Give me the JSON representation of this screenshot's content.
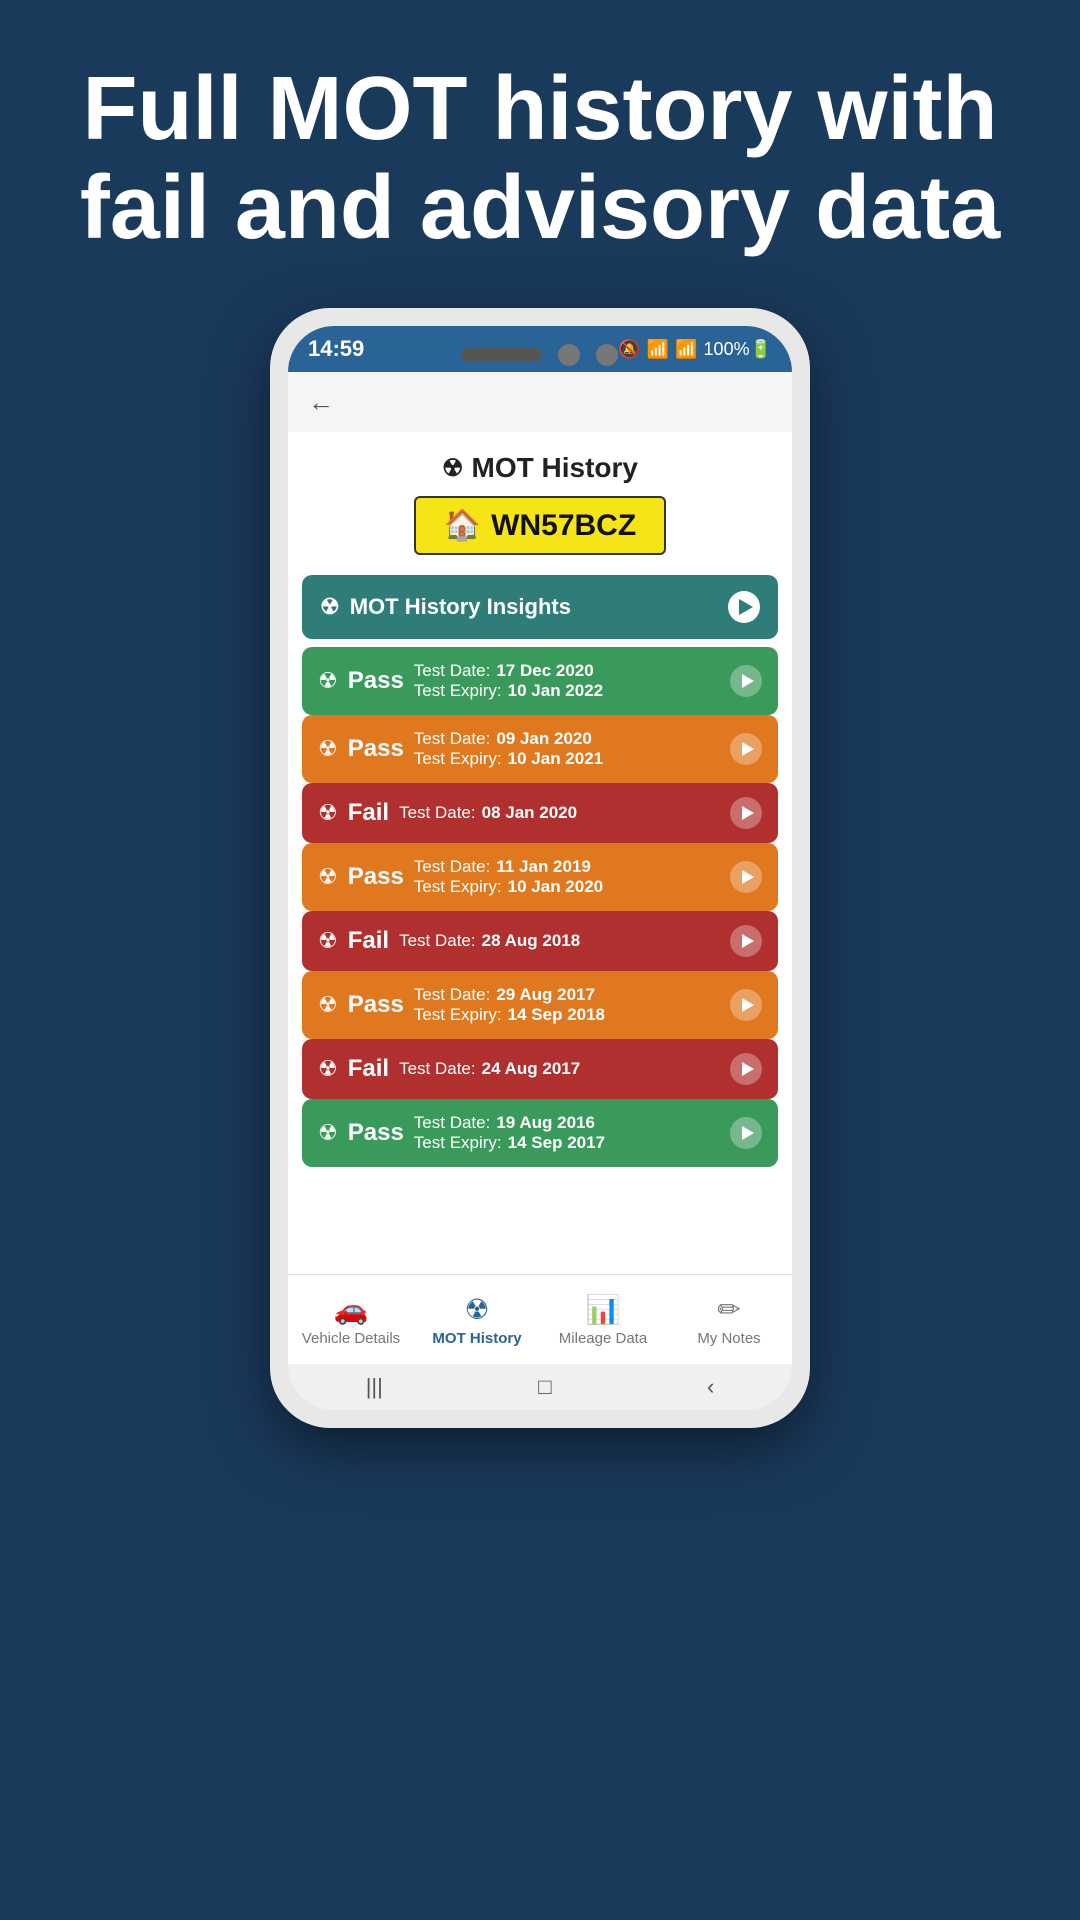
{
  "page": {
    "background_color": "#1a3a5c",
    "header_line1": "Full MOT history with",
    "header_line2": "fail and advisory data"
  },
  "status_bar": {
    "time": "14:59",
    "icons": "🔕 📶 📶 100%🔋"
  },
  "screen": {
    "title": "MOT History",
    "plate": "WN57BCZ",
    "insights_label": "MOT History Insights",
    "mot_entries": [
      {
        "result": "Pass",
        "color": "pass-green",
        "test_date_label": "Test Date:",
        "test_date_value": "17 Dec 2020",
        "expiry_label": "Test Expiry:",
        "expiry_value": "10 Jan 2022"
      },
      {
        "result": "Pass",
        "color": "pass-orange",
        "test_date_label": "Test Date:",
        "test_date_value": "09 Jan 2020",
        "expiry_label": "Test Expiry:",
        "expiry_value": "10 Jan 2021"
      },
      {
        "result": "Fail",
        "color": "fail-red",
        "test_date_label": "Test Date:",
        "test_date_value": "08 Jan 2020",
        "expiry_label": null,
        "expiry_value": null
      },
      {
        "result": "Pass",
        "color": "pass-orange",
        "test_date_label": "Test Date:",
        "test_date_value": "11 Jan 2019",
        "expiry_label": "Test Expiry:",
        "expiry_value": "10 Jan 2020"
      },
      {
        "result": "Fail",
        "color": "fail-red",
        "test_date_label": "Test Date:",
        "test_date_value": "28 Aug 2018",
        "expiry_label": null,
        "expiry_value": null
      },
      {
        "result": "Pass",
        "color": "pass-orange",
        "test_date_label": "Test Date:",
        "test_date_value": "29 Aug 2017",
        "expiry_label": "Test Expiry:",
        "expiry_value": "14 Sep 2018"
      },
      {
        "result": "Fail",
        "color": "fail-red",
        "test_date_label": "Test Date:",
        "test_date_value": "24 Aug 2017",
        "expiry_label": null,
        "expiry_value": null
      },
      {
        "result": "Pass",
        "color": "pass-green",
        "test_date_label": "Test Date:",
        "test_date_value": "19 Aug 2016",
        "expiry_label": "Test Expiry:",
        "expiry_value": "14 Sep 2017"
      }
    ]
  },
  "bottom_nav": {
    "items": [
      {
        "label": "Vehicle Details",
        "icon": "🚗",
        "active": false
      },
      {
        "label": "MOT History",
        "icon": "⚠",
        "active": true
      },
      {
        "label": "Mileage Data",
        "icon": "📊",
        "active": false
      },
      {
        "label": "My Notes",
        "icon": "✏",
        "active": false
      }
    ]
  },
  "phone_nav": {
    "back": "|||",
    "home": "□",
    "forward": "‹"
  }
}
